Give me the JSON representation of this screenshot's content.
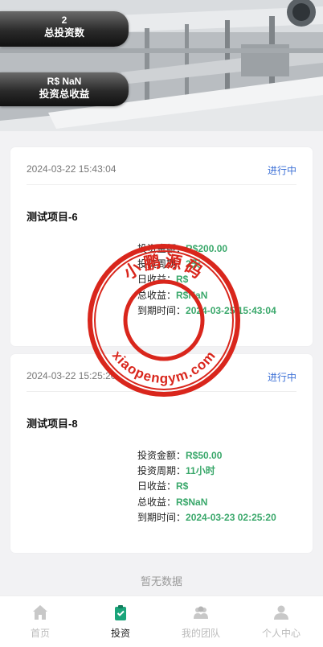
{
  "hero": {
    "stat1": {
      "value": "2",
      "label": "总投资数"
    },
    "stat2": {
      "value": "R$ NaN",
      "label": "投资总收益"
    }
  },
  "cards": [
    {
      "date": "2024-03-22 15:43:04",
      "status": "进行中",
      "title": "测试项目-6",
      "rows": [
        {
          "label": "投资金额：",
          "value": "R$200.00"
        },
        {
          "label": "投资周期：",
          "value": "2天"
        },
        {
          "label": "日收益：",
          "value": "R$"
        },
        {
          "label": "总收益：",
          "value": "R$NaN"
        },
        {
          "label": "到期时间：",
          "value": "2024-03-25 15:43:04"
        }
      ]
    },
    {
      "date": "2024-03-22 15:25:20",
      "status": "进行中",
      "title": "测试项目-8",
      "rows": [
        {
          "label": "投资金额：",
          "value": "R$50.00"
        },
        {
          "label": "投资周期：",
          "value": "11小时"
        },
        {
          "label": "日收益：",
          "value": "R$"
        },
        {
          "label": "总收益：",
          "value": "R$NaN"
        },
        {
          "label": "到期时间：",
          "value": "2024-03-23 02:25:20"
        }
      ]
    }
  ],
  "empty_text": "暂无数据",
  "tabbar": {
    "items": [
      {
        "label": "首页",
        "icon": "home-icon"
      },
      {
        "label": "投资",
        "icon": "clipboard-check-icon"
      },
      {
        "label": "我的团队",
        "icon": "team-icon"
      },
      {
        "label": "个人中心",
        "icon": "user-icon"
      }
    ],
    "active_color": "#1aa47a"
  },
  "watermark": {
    "top_text": "小鹏源码",
    "bottom_text": "xiaopengym.com",
    "color": "#d9261c"
  }
}
